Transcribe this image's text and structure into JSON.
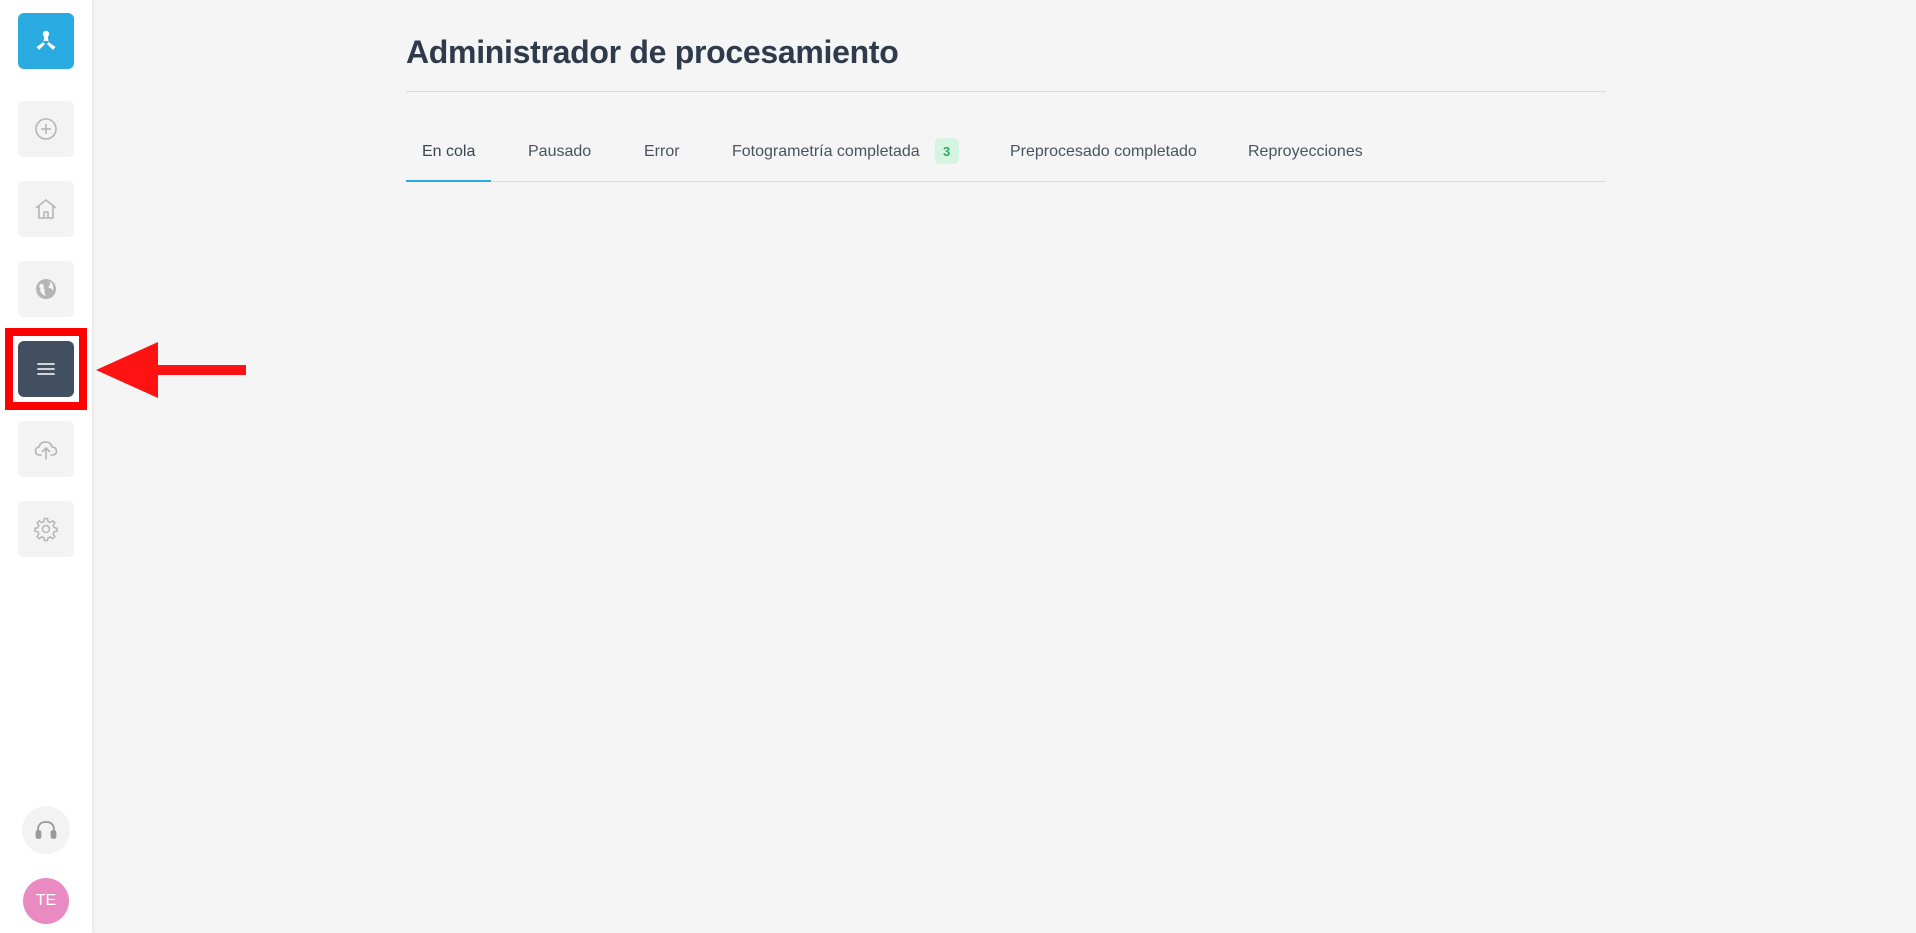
{
  "sidebar": {
    "items": [
      {
        "name": "logo",
        "icon": "logo-icon"
      },
      {
        "name": "add",
        "icon": "plus-circle-icon"
      },
      {
        "name": "home",
        "icon": "home-icon"
      },
      {
        "name": "globe",
        "icon": "globe-icon"
      },
      {
        "name": "menu",
        "icon": "menu-icon",
        "active": true
      },
      {
        "name": "upload",
        "icon": "cloud-upload-icon"
      },
      {
        "name": "settings",
        "icon": "gear-icon"
      }
    ],
    "support_icon": "headset-icon",
    "avatar_initials": "TE"
  },
  "header": {
    "title": "Administrador de procesamiento"
  },
  "tabs": [
    {
      "label": "En cola",
      "active": true
    },
    {
      "label": "Pausado"
    },
    {
      "label": "Error"
    },
    {
      "label": "Fotogrametría completada",
      "badge": "3"
    },
    {
      "label": "Preprocesado completado"
    },
    {
      "label": "Reproyecciones"
    }
  ],
  "colors": {
    "accent": "#29abe2",
    "active_button": "#424f61",
    "badge_bg": "#d5f5e3",
    "badge_text": "#27ae60",
    "annotation": "#ff0000",
    "avatar": "#e98bc2"
  }
}
